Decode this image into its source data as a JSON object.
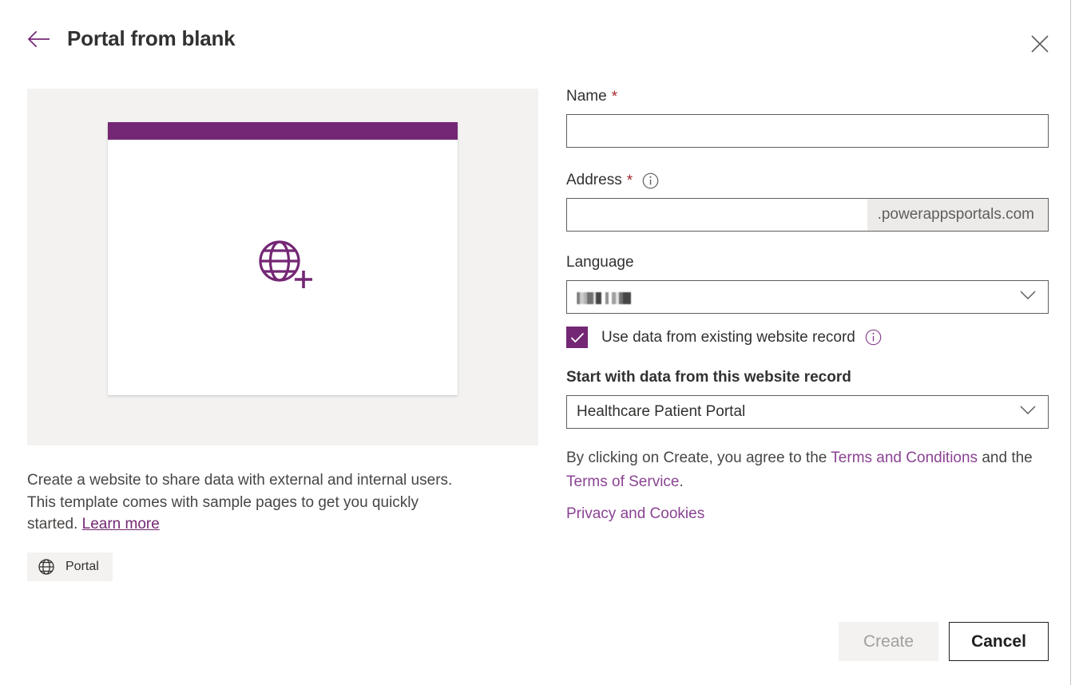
{
  "header": {
    "title": "Portal from blank",
    "back_icon": "arrow-left-icon",
    "close_icon": "close-icon"
  },
  "preview": {
    "icon": "globe-add-icon",
    "bar_color": "#742774",
    "pane_bg": "#f3f2f1"
  },
  "description": {
    "text_before_link": "Create a website to share data with external and internal users. This template comes with sample pages to get you quickly started. ",
    "link_label": "Learn more"
  },
  "tag": {
    "icon": "globe-icon",
    "label": "Portal"
  },
  "form": {
    "name": {
      "label": "Name",
      "required_marker": "*",
      "value": "",
      "placeholder": ""
    },
    "address": {
      "label": "Address",
      "required_marker": "*",
      "info_icon": "info-icon",
      "value": "",
      "placeholder": "",
      "suffix": ".powerappsportals.com"
    },
    "language": {
      "label": "Language",
      "value": "",
      "chevron_icon": "chevron-down-icon"
    },
    "use_existing_record": {
      "label": "Use data from existing website record",
      "checked": true,
      "check_icon": "checkmark-icon",
      "info_icon": "info-icon"
    },
    "website_record": {
      "label": "Start with data from this website record",
      "value": "Healthcare Patient Portal",
      "chevron_icon": "chevron-down-icon"
    }
  },
  "legal": {
    "prefix": "By clicking on Create, you agree to the ",
    "terms_conditions": "Terms and Conditions",
    "middle": " and the ",
    "terms_service": "Terms of Service",
    "suffix": ".",
    "privacy": "Privacy and Cookies"
  },
  "footer": {
    "create_label": "Create",
    "cancel_label": "Cancel"
  },
  "colors": {
    "brand_purple": "#742774",
    "link_purple": "#8a4392",
    "required_red": "#a4262c",
    "panel_gray": "#f3f2f1",
    "border_gray": "#605e5c"
  }
}
